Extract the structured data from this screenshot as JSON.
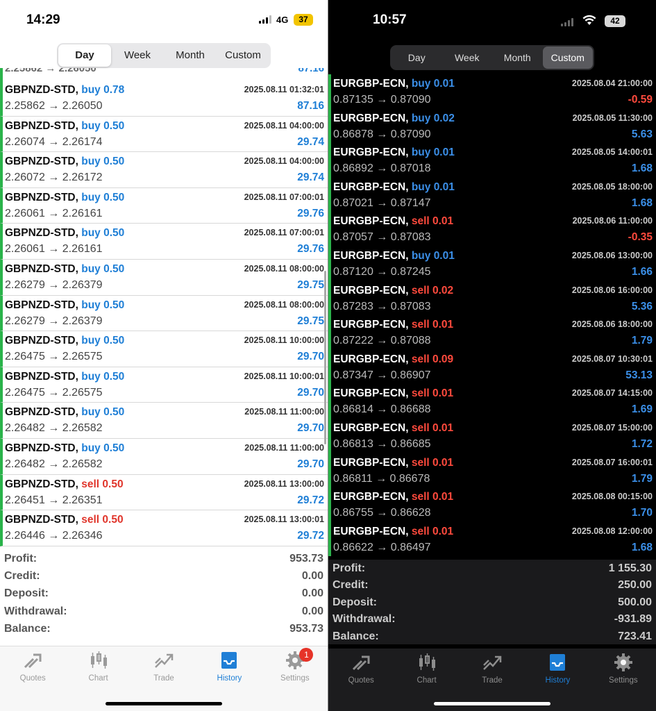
{
  "left": {
    "status": {
      "time": "14:29",
      "network": "4G",
      "battery": "37"
    },
    "segments": [
      {
        "label": "Day",
        "active": true
      },
      {
        "label": "Week",
        "active": false
      },
      {
        "label": "Month",
        "active": false
      },
      {
        "label": "Custom",
        "active": false
      }
    ],
    "partial_row": {
      "text": "2.25862 → 2.26050",
      "profit": "87.16"
    },
    "deals": [
      {
        "symbol": "GBPNZD-STD,",
        "action": "buy 0.78",
        "type": "buy",
        "datetime": "2025.08.11 01:32:01",
        "prices": "2.25862 → 2.26050",
        "profit": "87.16"
      },
      {
        "symbol": "GBPNZD-STD,",
        "action": "buy 0.50",
        "type": "buy",
        "datetime": "2025.08.11 04:00:00",
        "prices": "2.26074 → 2.26174",
        "profit": "29.74"
      },
      {
        "symbol": "GBPNZD-STD,",
        "action": "buy 0.50",
        "type": "buy",
        "datetime": "2025.08.11 04:00:00",
        "prices": "2.26072 → 2.26172",
        "profit": "29.74"
      },
      {
        "symbol": "GBPNZD-STD,",
        "action": "buy 0.50",
        "type": "buy",
        "datetime": "2025.08.11 07:00:01",
        "prices": "2.26061 → 2.26161",
        "profit": "29.76"
      },
      {
        "symbol": "GBPNZD-STD,",
        "action": "buy 0.50",
        "type": "buy",
        "datetime": "2025.08.11 07:00:01",
        "prices": "2.26061 → 2.26161",
        "profit": "29.76"
      },
      {
        "symbol": "GBPNZD-STD,",
        "action": "buy 0.50",
        "type": "buy",
        "datetime": "2025.08.11 08:00:00",
        "prices": "2.26279 → 2.26379",
        "profit": "29.75"
      },
      {
        "symbol": "GBPNZD-STD,",
        "action": "buy 0.50",
        "type": "buy",
        "datetime": "2025.08.11 08:00:00",
        "prices": "2.26279 → 2.26379",
        "profit": "29.75"
      },
      {
        "symbol": "GBPNZD-STD,",
        "action": "buy 0.50",
        "type": "buy",
        "datetime": "2025.08.11 10:00:00",
        "prices": "2.26475 → 2.26575",
        "profit": "29.70"
      },
      {
        "symbol": "GBPNZD-STD,",
        "action": "buy 0.50",
        "type": "buy",
        "datetime": "2025.08.11 10:00:01",
        "prices": "2.26475 → 2.26575",
        "profit": "29.70"
      },
      {
        "symbol": "GBPNZD-STD,",
        "action": "buy 0.50",
        "type": "buy",
        "datetime": "2025.08.11 11:00:00",
        "prices": "2.26482 → 2.26582",
        "profit": "29.70"
      },
      {
        "symbol": "GBPNZD-STD,",
        "action": "buy 0.50",
        "type": "buy",
        "datetime": "2025.08.11 11:00:00",
        "prices": "2.26482 → 2.26582",
        "profit": "29.70"
      },
      {
        "symbol": "GBPNZD-STD,",
        "action": "sell 0.50",
        "type": "sell",
        "datetime": "2025.08.11 13:00:00",
        "prices": "2.26451 → 2.26351",
        "profit": "29.72"
      },
      {
        "symbol": "GBPNZD-STD,",
        "action": "sell 0.50",
        "type": "sell",
        "datetime": "2025.08.11 13:00:01",
        "prices": "2.26446 → 2.26346",
        "profit": "29.72"
      }
    ],
    "summary": [
      {
        "label": "Profit:",
        "value": "953.73"
      },
      {
        "label": "Credit:",
        "value": "0.00"
      },
      {
        "label": "Deposit:",
        "value": "0.00"
      },
      {
        "label": "Withdrawal:",
        "value": "0.00"
      },
      {
        "label": "Balance:",
        "value": "953.73"
      }
    ],
    "tabs": [
      {
        "label": "Quotes",
        "icon": "quotes-icon",
        "active": false
      },
      {
        "label": "Chart",
        "icon": "chart-icon",
        "active": false
      },
      {
        "label": "Trade",
        "icon": "trade-icon",
        "active": false
      },
      {
        "label": "History",
        "icon": "history-icon",
        "active": true
      },
      {
        "label": "Settings",
        "icon": "gear-icon",
        "active": false,
        "badge": "1"
      }
    ]
  },
  "right": {
    "status": {
      "time": "10:57",
      "battery": "42"
    },
    "segments": [
      {
        "label": "Day",
        "active": false
      },
      {
        "label": "Week",
        "active": false
      },
      {
        "label": "Month",
        "active": false
      },
      {
        "label": "Custom",
        "active": true
      }
    ],
    "deals": [
      {
        "symbol": "EURGBP-ECN,",
        "action": "buy 0.01",
        "type": "buy",
        "datetime": "2025.08.04 21:00:00",
        "prices": "0.87135 → 0.87090",
        "profit": "-0.59",
        "sign": "neg"
      },
      {
        "symbol": "EURGBP-ECN,",
        "action": "buy 0.02",
        "type": "buy",
        "datetime": "2025.08.05 11:30:00",
        "prices": "0.86878 → 0.87090",
        "profit": "5.63",
        "sign": "pos"
      },
      {
        "symbol": "EURGBP-ECN,",
        "action": "buy 0.01",
        "type": "buy",
        "datetime": "2025.08.05 14:00:01",
        "prices": "0.86892 → 0.87018",
        "profit": "1.68",
        "sign": "pos"
      },
      {
        "symbol": "EURGBP-ECN,",
        "action": "buy 0.01",
        "type": "buy",
        "datetime": "2025.08.05 18:00:00",
        "prices": "0.87021 → 0.87147",
        "profit": "1.68",
        "sign": "pos"
      },
      {
        "symbol": "EURGBP-ECN,",
        "action": "sell 0.01",
        "type": "sell",
        "datetime": "2025.08.06 11:00:00",
        "prices": "0.87057 → 0.87083",
        "profit": "-0.35",
        "sign": "neg"
      },
      {
        "symbol": "EURGBP-ECN,",
        "action": "buy 0.01",
        "type": "buy",
        "datetime": "2025.08.06 13:00:00",
        "prices": "0.87120 → 0.87245",
        "profit": "1.66",
        "sign": "pos"
      },
      {
        "symbol": "EURGBP-ECN,",
        "action": "sell 0.02",
        "type": "sell",
        "datetime": "2025.08.06 16:00:00",
        "prices": "0.87283 → 0.87083",
        "profit": "5.36",
        "sign": "pos"
      },
      {
        "symbol": "EURGBP-ECN,",
        "action": "sell 0.01",
        "type": "sell",
        "datetime": "2025.08.06 18:00:00",
        "prices": "0.87222 → 0.87088",
        "profit": "1.79",
        "sign": "pos"
      },
      {
        "symbol": "EURGBP-ECN,",
        "action": "sell 0.09",
        "type": "sell",
        "datetime": "2025.08.07 10:30:01",
        "prices": "0.87347 → 0.86907",
        "profit": "53.13",
        "sign": "pos"
      },
      {
        "symbol": "EURGBP-ECN,",
        "action": "sell 0.01",
        "type": "sell",
        "datetime": "2025.08.07 14:15:00",
        "prices": "0.86814 → 0.86688",
        "profit": "1.69",
        "sign": "pos"
      },
      {
        "symbol": "EURGBP-ECN,",
        "action": "sell 0.01",
        "type": "sell",
        "datetime": "2025.08.07 15:00:00",
        "prices": "0.86813 → 0.86685",
        "profit": "1.72",
        "sign": "pos"
      },
      {
        "symbol": "EURGBP-ECN,",
        "action": "sell 0.01",
        "type": "sell",
        "datetime": "2025.08.07 16:00:01",
        "prices": "0.86811 → 0.86678",
        "profit": "1.79",
        "sign": "pos"
      },
      {
        "symbol": "EURGBP-ECN,",
        "action": "sell 0.01",
        "type": "sell",
        "datetime": "2025.08.08 00:15:00",
        "prices": "0.86755 → 0.86628",
        "profit": "1.70",
        "sign": "pos"
      },
      {
        "symbol": "EURGBP-ECN,",
        "action": "sell 0.01",
        "type": "sell",
        "datetime": "2025.08.08 12:00:00",
        "prices": "0.86622 → 0.86497",
        "profit": "1.68",
        "sign": "pos"
      }
    ],
    "summary": [
      {
        "label": "Profit:",
        "value": "1 155.30"
      },
      {
        "label": "Credit:",
        "value": "250.00"
      },
      {
        "label": "Deposit:",
        "value": "500.00"
      },
      {
        "label": "Withdrawal:",
        "value": "-931.89"
      },
      {
        "label": "Balance:",
        "value": "723.41"
      }
    ],
    "tabs": [
      {
        "label": "Quotes",
        "icon": "quotes-icon",
        "active": false
      },
      {
        "label": "Chart",
        "icon": "chart-icon",
        "active": false
      },
      {
        "label": "Trade",
        "icon": "trade-icon",
        "active": false
      },
      {
        "label": "History",
        "icon": "history-icon",
        "active": true
      },
      {
        "label": "Settings",
        "icon": "gear-icon",
        "active": false
      }
    ]
  },
  "colors": {
    "buy": "#1f7fd6",
    "sell": "#e0352b",
    "accent": "#1f7fd6",
    "row_marker": "#2ab34a"
  }
}
